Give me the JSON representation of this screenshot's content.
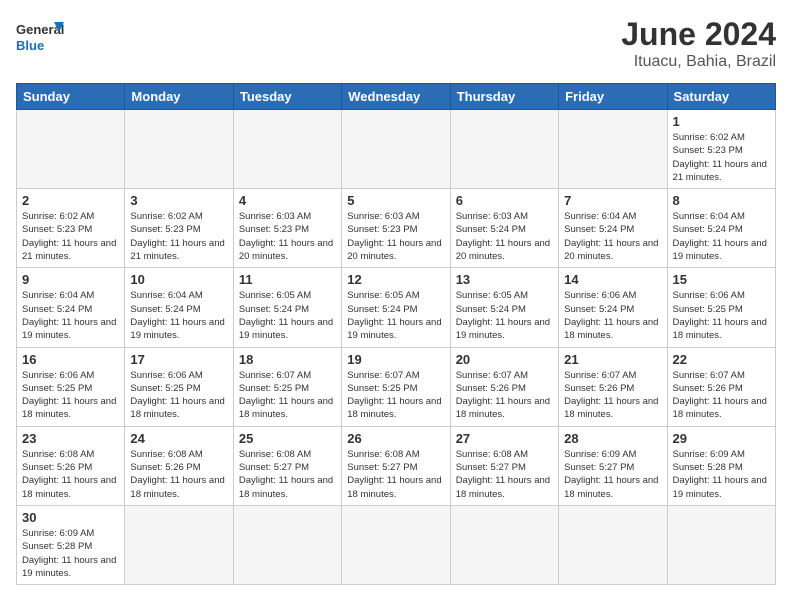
{
  "header": {
    "logo_general": "General",
    "logo_blue": "Blue",
    "title": "June 2024",
    "subtitle": "Ituacu, Bahia, Brazil"
  },
  "weekdays": [
    "Sunday",
    "Monday",
    "Tuesday",
    "Wednesday",
    "Thursday",
    "Friday",
    "Saturday"
  ],
  "weeks": [
    [
      {
        "day": "",
        "empty": true
      },
      {
        "day": "",
        "empty": true
      },
      {
        "day": "",
        "empty": true
      },
      {
        "day": "",
        "empty": true
      },
      {
        "day": "",
        "empty": true
      },
      {
        "day": "",
        "empty": true
      },
      {
        "day": "1",
        "sunrise": "6:02 AM",
        "sunset": "5:23 PM",
        "daylight": "11 hours and 21 minutes."
      }
    ],
    [
      {
        "day": "2",
        "sunrise": "6:02 AM",
        "sunset": "5:23 PM",
        "daylight": "11 hours and 21 minutes."
      },
      {
        "day": "3",
        "sunrise": "6:02 AM",
        "sunset": "5:23 PM",
        "daylight": "11 hours and 21 minutes."
      },
      {
        "day": "4",
        "sunrise": "6:03 AM",
        "sunset": "5:23 PM",
        "daylight": "11 hours and 20 minutes."
      },
      {
        "day": "5",
        "sunrise": "6:03 AM",
        "sunset": "5:23 PM",
        "daylight": "11 hours and 20 minutes."
      },
      {
        "day": "6",
        "sunrise": "6:03 AM",
        "sunset": "5:24 PM",
        "daylight": "11 hours and 20 minutes."
      },
      {
        "day": "7",
        "sunrise": "6:04 AM",
        "sunset": "5:24 PM",
        "daylight": "11 hours and 20 minutes."
      },
      {
        "day": "8",
        "sunrise": "6:04 AM",
        "sunset": "5:24 PM",
        "daylight": "11 hours and 19 minutes."
      }
    ],
    [
      {
        "day": "9",
        "sunrise": "6:04 AM",
        "sunset": "5:24 PM",
        "daylight": "11 hours and 19 minutes."
      },
      {
        "day": "10",
        "sunrise": "6:04 AM",
        "sunset": "5:24 PM",
        "daylight": "11 hours and 19 minutes."
      },
      {
        "day": "11",
        "sunrise": "6:05 AM",
        "sunset": "5:24 PM",
        "daylight": "11 hours and 19 minutes."
      },
      {
        "day": "12",
        "sunrise": "6:05 AM",
        "sunset": "5:24 PM",
        "daylight": "11 hours and 19 minutes."
      },
      {
        "day": "13",
        "sunrise": "6:05 AM",
        "sunset": "5:24 PM",
        "daylight": "11 hours and 19 minutes."
      },
      {
        "day": "14",
        "sunrise": "6:06 AM",
        "sunset": "5:24 PM",
        "daylight": "11 hours and 18 minutes."
      },
      {
        "day": "15",
        "sunrise": "6:06 AM",
        "sunset": "5:25 PM",
        "daylight": "11 hours and 18 minutes."
      }
    ],
    [
      {
        "day": "16",
        "sunrise": "6:06 AM",
        "sunset": "5:25 PM",
        "daylight": "11 hours and 18 minutes."
      },
      {
        "day": "17",
        "sunrise": "6:06 AM",
        "sunset": "5:25 PM",
        "daylight": "11 hours and 18 minutes."
      },
      {
        "day": "18",
        "sunrise": "6:07 AM",
        "sunset": "5:25 PM",
        "daylight": "11 hours and 18 minutes."
      },
      {
        "day": "19",
        "sunrise": "6:07 AM",
        "sunset": "5:25 PM",
        "daylight": "11 hours and 18 minutes."
      },
      {
        "day": "20",
        "sunrise": "6:07 AM",
        "sunset": "5:26 PM",
        "daylight": "11 hours and 18 minutes."
      },
      {
        "day": "21",
        "sunrise": "6:07 AM",
        "sunset": "5:26 PM",
        "daylight": "11 hours and 18 minutes."
      },
      {
        "day": "22",
        "sunrise": "6:07 AM",
        "sunset": "5:26 PM",
        "daylight": "11 hours and 18 minutes."
      }
    ],
    [
      {
        "day": "23",
        "sunrise": "6:08 AM",
        "sunset": "5:26 PM",
        "daylight": "11 hours and 18 minutes."
      },
      {
        "day": "24",
        "sunrise": "6:08 AM",
        "sunset": "5:26 PM",
        "daylight": "11 hours and 18 minutes."
      },
      {
        "day": "25",
        "sunrise": "6:08 AM",
        "sunset": "5:27 PM",
        "daylight": "11 hours and 18 minutes."
      },
      {
        "day": "26",
        "sunrise": "6:08 AM",
        "sunset": "5:27 PM",
        "daylight": "11 hours and 18 minutes."
      },
      {
        "day": "27",
        "sunrise": "6:08 AM",
        "sunset": "5:27 PM",
        "daylight": "11 hours and 18 minutes."
      },
      {
        "day": "28",
        "sunrise": "6:09 AM",
        "sunset": "5:27 PM",
        "daylight": "11 hours and 18 minutes."
      },
      {
        "day": "29",
        "sunrise": "6:09 AM",
        "sunset": "5:28 PM",
        "daylight": "11 hours and 19 minutes."
      }
    ],
    [
      {
        "day": "30",
        "sunrise": "6:09 AM",
        "sunset": "5:28 PM",
        "daylight": "11 hours and 19 minutes."
      },
      {
        "day": "",
        "empty": true
      },
      {
        "day": "",
        "empty": true
      },
      {
        "day": "",
        "empty": true
      },
      {
        "day": "",
        "empty": true
      },
      {
        "day": "",
        "empty": true
      },
      {
        "day": "",
        "empty": true
      }
    ]
  ],
  "labels": {
    "sunrise": "Sunrise:",
    "sunset": "Sunset:",
    "daylight": "Daylight:"
  }
}
